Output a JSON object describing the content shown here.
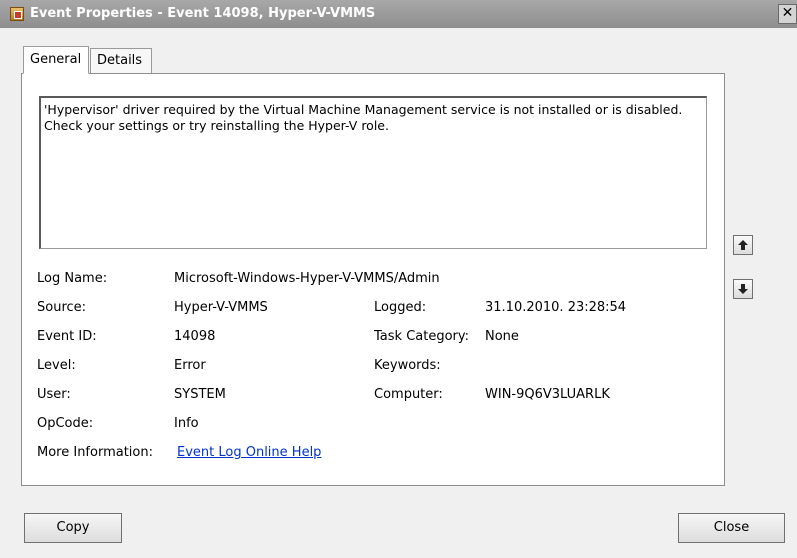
{
  "window": {
    "title": "Event Properties - Event 14098, Hyper-V-VMMS",
    "close_glyph": "✕",
    "icon": "event-viewer-icon"
  },
  "tabs": [
    {
      "label": "General",
      "selected": true
    },
    {
      "label": "Details",
      "selected": false
    }
  ],
  "description": "'Hypervisor' driver required by the Virtual Machine Management service is not installed or is disabled. Check your settings or try reinstalling the Hyper-V role.",
  "fields": {
    "log_name": {
      "label": "Log Name:",
      "value": "Microsoft-Windows-Hyper-V-VMMS/Admin"
    },
    "source": {
      "label": "Source:",
      "value": "Hyper-V-VMMS"
    },
    "logged": {
      "label": "Logged:",
      "value": "31.10.2010. 23:28:54"
    },
    "event_id": {
      "label": "Event ID:",
      "value": "14098"
    },
    "task_category": {
      "label": "Task Category:",
      "value": "None"
    },
    "level": {
      "label": "Level:",
      "value": "Error"
    },
    "keywords": {
      "label": "Keywords:",
      "value": ""
    },
    "user": {
      "label": "User:",
      "value": "SYSTEM"
    },
    "computer": {
      "label": "Computer:",
      "value": "WIN-9Q6V3LUARLK"
    },
    "opcode": {
      "label": "OpCode:",
      "value": "Info"
    },
    "more_info": {
      "label": "More Information:",
      "link": "Event Log Online Help"
    }
  },
  "nav": {
    "up_icon": "arrow-up-icon",
    "down_icon": "arrow-down-icon"
  },
  "buttons": {
    "copy": "Copy",
    "close": "Close"
  },
  "colors": {
    "titlebar": "#9a9a9a",
    "link": "#0033cc"
  }
}
